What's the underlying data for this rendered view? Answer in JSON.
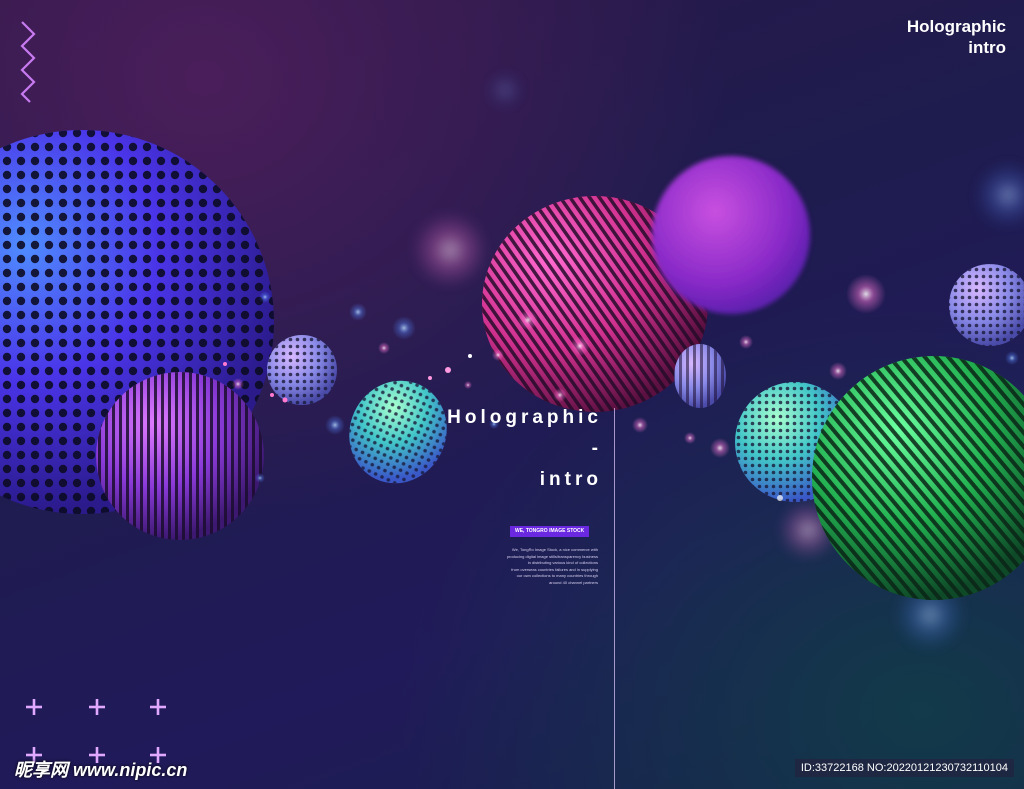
{
  "poster": {
    "corner_title_line1": "Holographic",
    "corner_title_line2": "intro",
    "center_title_line1": "Holographic",
    "center_title_line2": "-",
    "center_title_line3": "intro",
    "badge": "WE, TONGRO IMAGE STOCK",
    "body_lines": [
      "We, TongRo Image Stock, a nice commerce with",
      "producing digital image stills/transparency business",
      "in distributing various kind of collections",
      "from overseas countries failures and in supplying",
      "our own collections to many countries through",
      "around 40 channel partners"
    ]
  },
  "watermark": {
    "left": "昵享网 www.nipic.cn",
    "id": "ID:33722168 NO:20220121230732110104"
  },
  "colors": {
    "background_dark": "#1e1c4e",
    "accent_purple": "#6a28e0",
    "sphere_pink": "#d83aa8",
    "sphere_green": "#2bd46a",
    "sphere_blue": "#3a4af0"
  }
}
